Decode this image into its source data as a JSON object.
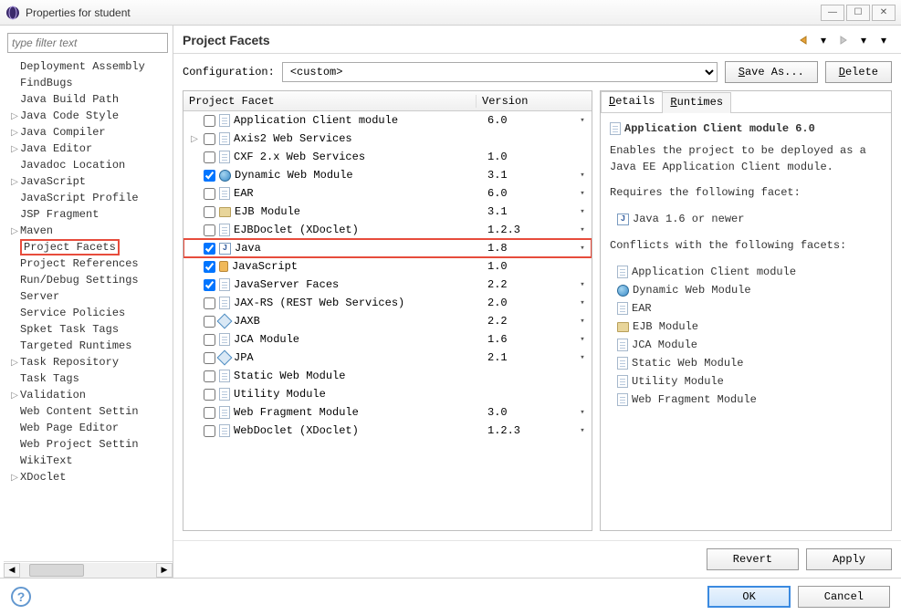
{
  "window": {
    "title": "Properties for student"
  },
  "sidebar": {
    "filter_placeholder": "type filter text",
    "items": [
      {
        "label": "Deployment Assembly",
        "exp": ""
      },
      {
        "label": "FindBugs",
        "exp": ""
      },
      {
        "label": "Java Build Path",
        "exp": ""
      },
      {
        "label": "Java Code Style",
        "exp": "▷"
      },
      {
        "label": "Java Compiler",
        "exp": "▷"
      },
      {
        "label": "Java Editor",
        "exp": "▷"
      },
      {
        "label": "Javadoc Location",
        "exp": ""
      },
      {
        "label": "JavaScript",
        "exp": "▷"
      },
      {
        "label": "JavaScript Profile",
        "exp": ""
      },
      {
        "label": "JSP Fragment",
        "exp": ""
      },
      {
        "label": "Maven",
        "exp": "▷"
      },
      {
        "label": "Project Facets",
        "exp": "",
        "selected": true
      },
      {
        "label": "Project References",
        "exp": ""
      },
      {
        "label": "Run/Debug Settings",
        "exp": ""
      },
      {
        "label": "Server",
        "exp": ""
      },
      {
        "label": "Service Policies",
        "exp": ""
      },
      {
        "label": "Spket Task Tags",
        "exp": ""
      },
      {
        "label": "Targeted Runtimes",
        "exp": ""
      },
      {
        "label": "Task Repository",
        "exp": "▷"
      },
      {
        "label": "Task Tags",
        "exp": ""
      },
      {
        "label": "Validation",
        "exp": "▷"
      },
      {
        "label": "Web Content Settin",
        "exp": ""
      },
      {
        "label": "Web Page Editor",
        "exp": ""
      },
      {
        "label": "Web Project Settin",
        "exp": ""
      },
      {
        "label": "WikiText",
        "exp": ""
      },
      {
        "label": "XDoclet",
        "exp": "▷"
      }
    ]
  },
  "header": {
    "title": "Project Facets"
  },
  "config": {
    "label": "Configuration:",
    "value": "<custom>",
    "save_as": "Save As...",
    "delete": "Delete"
  },
  "facet_table": {
    "col1": "Project Facet",
    "col2": "Version",
    "rows": [
      {
        "exp": "",
        "chk": false,
        "icon": "page",
        "label": "Application Client module",
        "ver": "6.0",
        "dd": true
      },
      {
        "exp": "▷",
        "chk": false,
        "icon": "page",
        "label": "Axis2 Web Services",
        "ver": "",
        "dd": false
      },
      {
        "exp": "",
        "chk": false,
        "icon": "page",
        "label": "CXF 2.x Web Services",
        "ver": "1.0",
        "dd": false
      },
      {
        "exp": "",
        "chk": true,
        "icon": "globe",
        "label": "Dynamic Web Module",
        "ver": "3.1",
        "dd": true
      },
      {
        "exp": "",
        "chk": false,
        "icon": "page",
        "label": "EAR",
        "ver": "6.0",
        "dd": true
      },
      {
        "exp": "",
        "chk": false,
        "icon": "jar",
        "label": "EJB Module",
        "ver": "3.1",
        "dd": true
      },
      {
        "exp": "",
        "chk": false,
        "icon": "page",
        "label": "EJBDoclet (XDoclet)",
        "ver": "1.2.3",
        "dd": true
      },
      {
        "exp": "",
        "chk": true,
        "icon": "j",
        "label": "Java",
        "ver": "1.8",
        "dd": true,
        "hl": true
      },
      {
        "exp": "",
        "chk": true,
        "icon": "lock",
        "label": "JavaScript",
        "ver": "1.0",
        "dd": false
      },
      {
        "exp": "",
        "chk": true,
        "icon": "page",
        "label": "JavaServer Faces",
        "ver": "2.2",
        "dd": true
      },
      {
        "exp": "",
        "chk": false,
        "icon": "page",
        "label": "JAX-RS (REST Web Services)",
        "ver": "2.0",
        "dd": true
      },
      {
        "exp": "",
        "chk": false,
        "icon": "dia",
        "label": "JAXB",
        "ver": "2.2",
        "dd": true
      },
      {
        "exp": "",
        "chk": false,
        "icon": "page",
        "label": "JCA Module",
        "ver": "1.6",
        "dd": true
      },
      {
        "exp": "",
        "chk": false,
        "icon": "dia",
        "label": "JPA",
        "ver": "2.1",
        "dd": true
      },
      {
        "exp": "",
        "chk": false,
        "icon": "page",
        "label": "Static Web Module",
        "ver": "",
        "dd": false
      },
      {
        "exp": "",
        "chk": false,
        "icon": "page",
        "label": "Utility Module",
        "ver": "",
        "dd": false
      },
      {
        "exp": "",
        "chk": false,
        "icon": "page",
        "label": "Web Fragment Module",
        "ver": "3.0",
        "dd": true
      },
      {
        "exp": "",
        "chk": false,
        "icon": "page",
        "label": "WebDoclet (XDoclet)",
        "ver": "1.2.3",
        "dd": true
      }
    ]
  },
  "details": {
    "tab_details": "Details",
    "tab_runtimes": "Runtimes",
    "title": "Application Client module 6.0",
    "desc": "Enables the project to be deployed as a Java EE Application Client module.",
    "req_label": "Requires the following facet:",
    "req_items": [
      {
        "icon": "j",
        "label": "Java 1.6 or newer"
      }
    ],
    "conf_label": "Conflicts with the following facets:",
    "conf_items": [
      {
        "icon": "page",
        "label": "Application Client module"
      },
      {
        "icon": "globe",
        "label": "Dynamic Web Module"
      },
      {
        "icon": "page",
        "label": "EAR"
      },
      {
        "icon": "jar",
        "label": "EJB Module"
      },
      {
        "icon": "page",
        "label": "JCA Module"
      },
      {
        "icon": "page",
        "label": "Static Web Module"
      },
      {
        "icon": "page",
        "label": "Utility Module"
      },
      {
        "icon": "page",
        "label": "Web Fragment Module"
      }
    ]
  },
  "buttons": {
    "revert": "Revert",
    "apply": "Apply",
    "ok": "OK",
    "cancel": "Cancel"
  }
}
